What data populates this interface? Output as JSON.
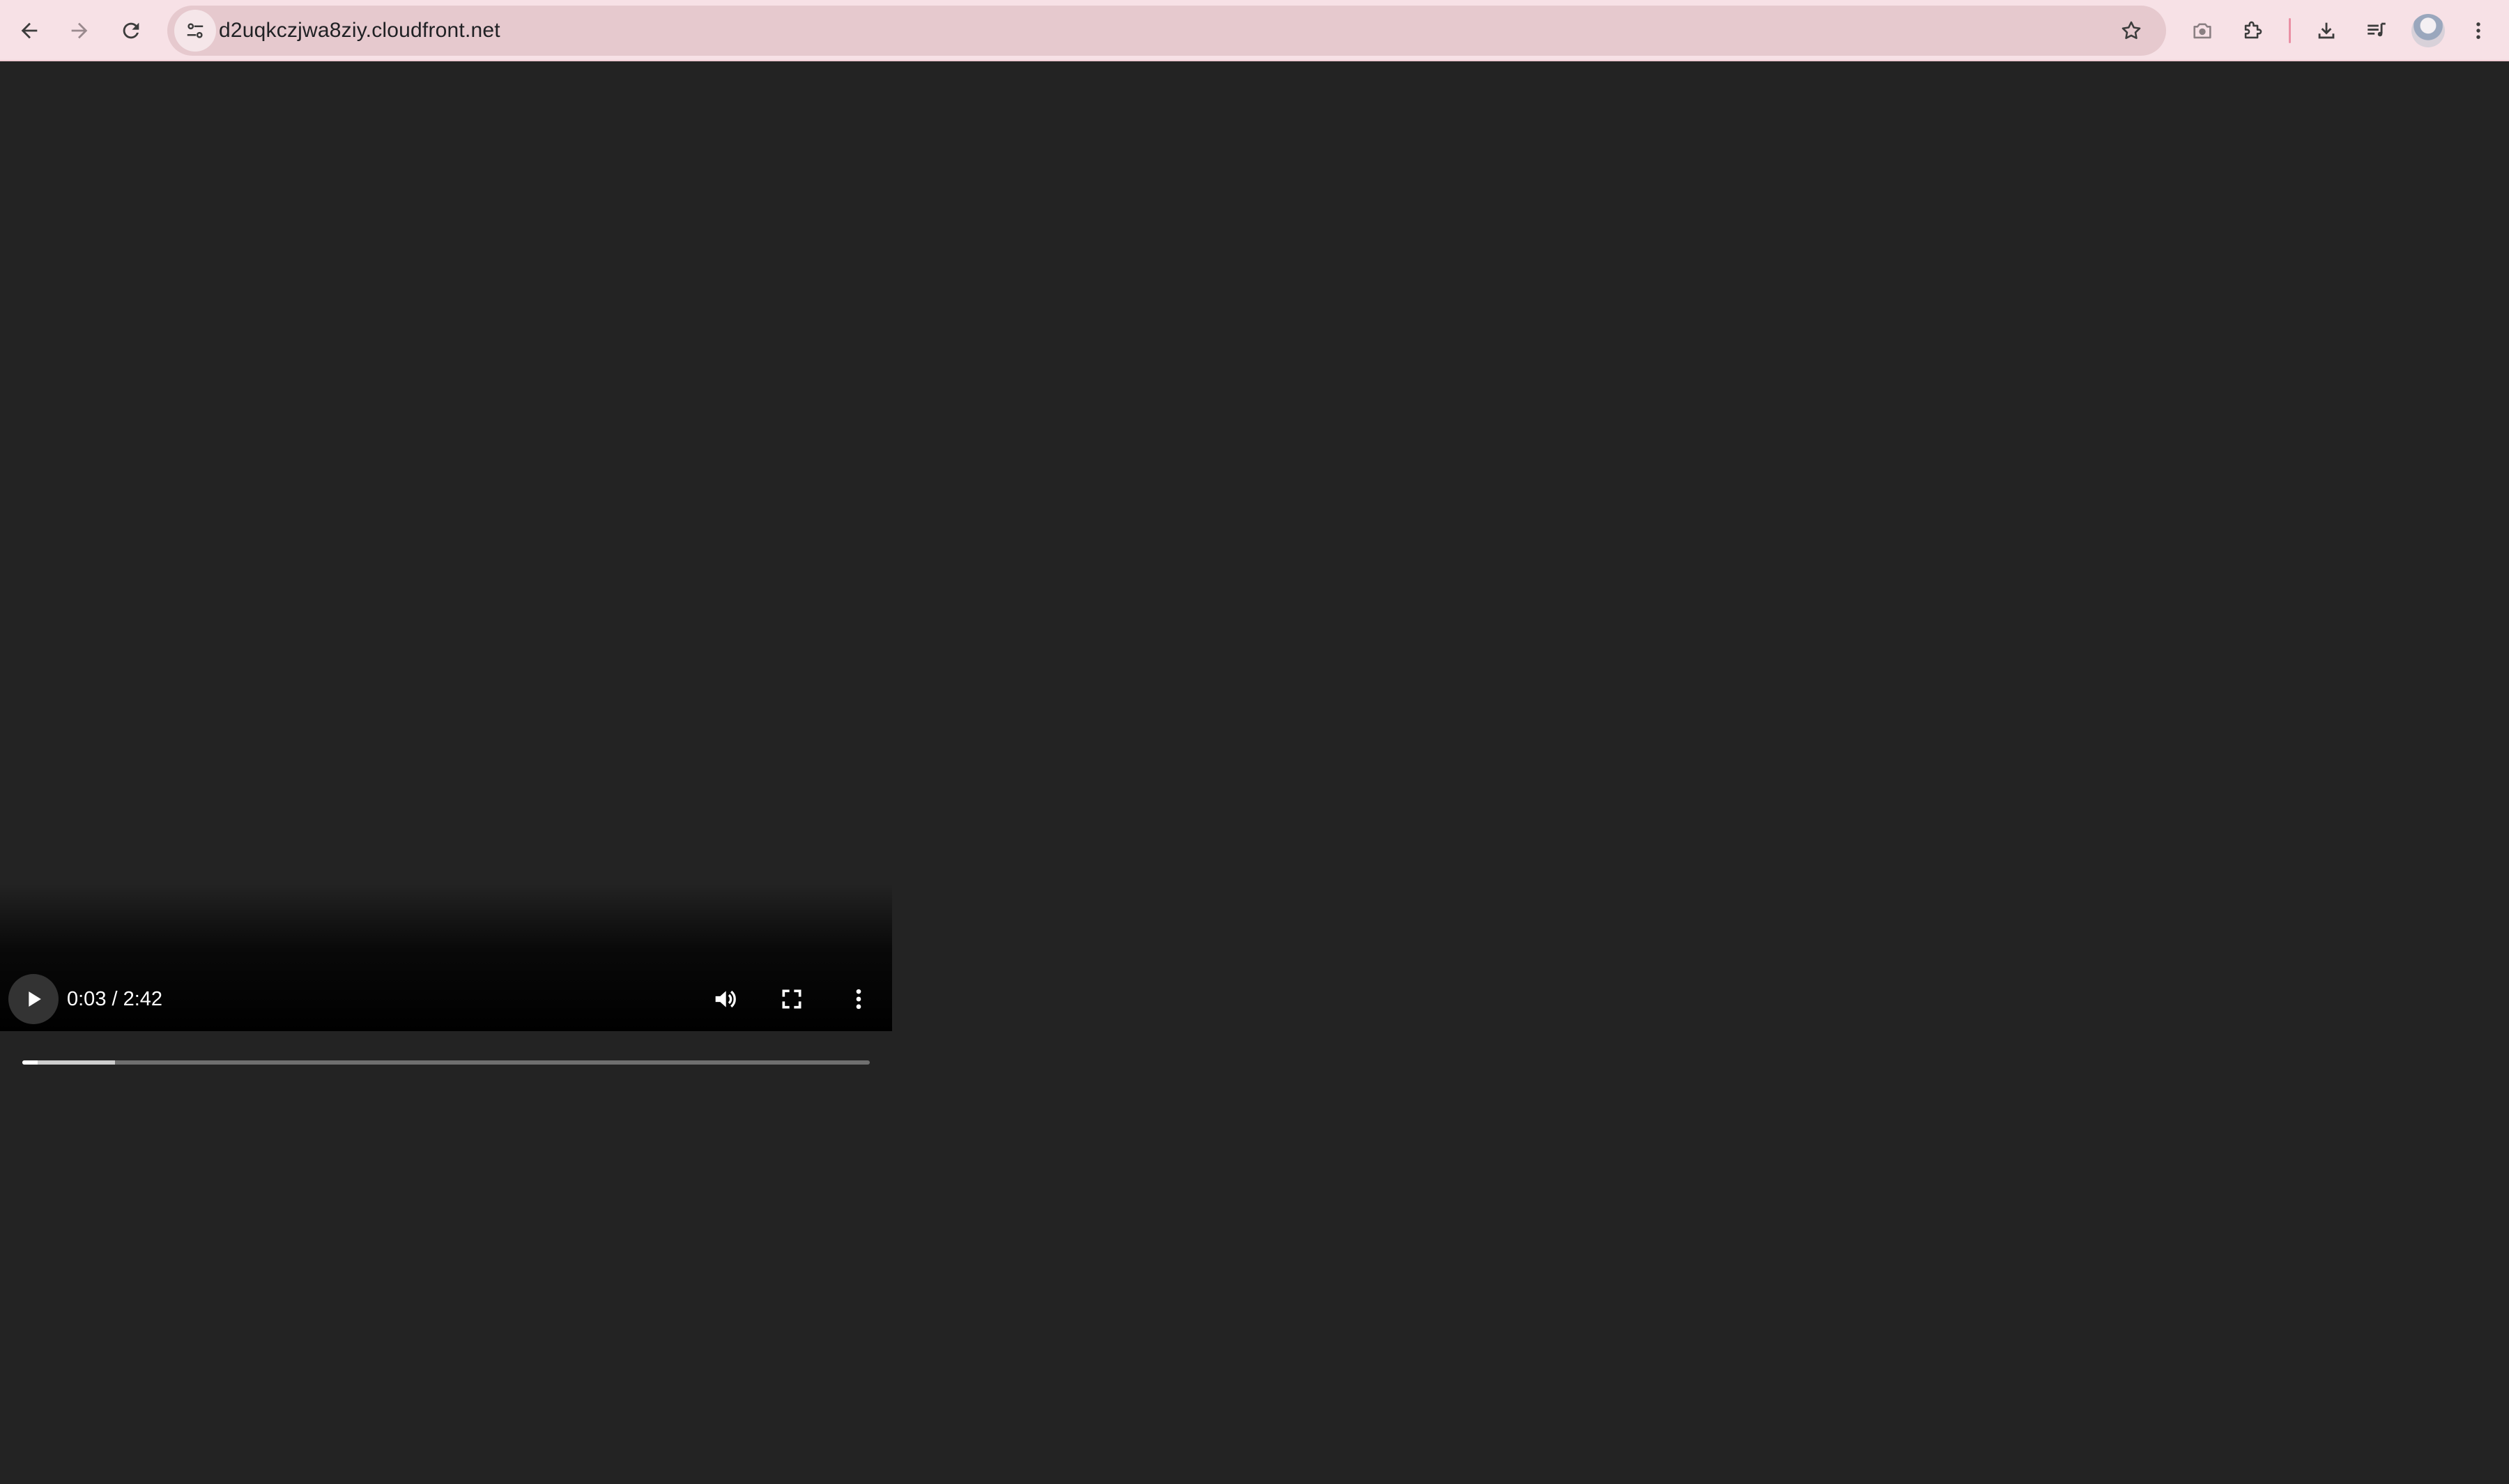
{
  "browser": {
    "url": "d2uqkczjwa8ziy.cloudfront.net",
    "toolbar_color": "#f7e1e6",
    "omnibox_color": "#e6c9ce",
    "icons": [
      "back-icon",
      "forward-icon",
      "reload-icon",
      "site-info-icon",
      "bookmark-star-icon",
      "camera-icon",
      "extensions-icon",
      "downloads-icon",
      "media-queue-icon",
      "profile-avatar",
      "more-vert-icon"
    ]
  },
  "video_player": {
    "time_display": "0:03 / 2:42",
    "current_time": "0:03",
    "duration": "2:42",
    "progress_fraction": 0.0185,
    "buffered_fraction": 0.109,
    "state": "paused",
    "controls": [
      "play",
      "volume",
      "fullscreen",
      "more-options"
    ],
    "background_color": "#232323"
  }
}
